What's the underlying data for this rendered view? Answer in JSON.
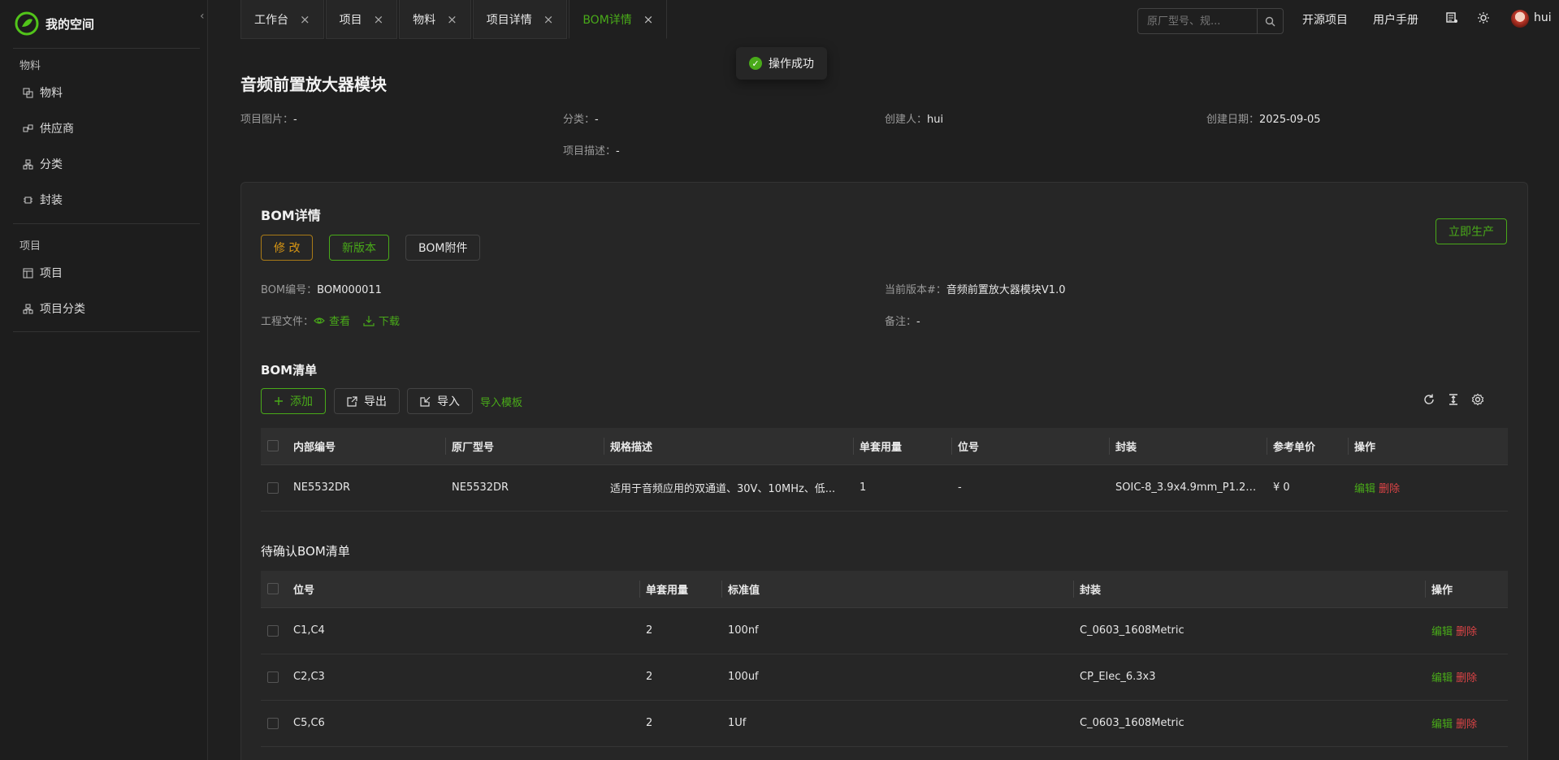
{
  "sidebar": {
    "logo_text": "我的空间",
    "groups": [
      {
        "label": "物料",
        "items": [
          {
            "label": "物料",
            "icon": "materials-icon"
          },
          {
            "label": "供应商",
            "icon": "supplier-icon"
          },
          {
            "label": "分类",
            "icon": "category-icon"
          },
          {
            "label": "封装",
            "icon": "package-icon"
          }
        ]
      },
      {
        "label": "项目",
        "items": [
          {
            "label": "项目",
            "icon": "project-icon"
          },
          {
            "label": "项目分类",
            "icon": "project-category-icon"
          }
        ]
      }
    ]
  },
  "tabs": [
    {
      "label": "工作台",
      "active": false
    },
    {
      "label": "项目",
      "active": false
    },
    {
      "label": "物料",
      "active": false
    },
    {
      "label": "项目详情",
      "active": false
    },
    {
      "label": "BOM详情",
      "active": true
    }
  ],
  "header": {
    "search_placeholder": "原厂型号、规...",
    "open_source": "开源项目",
    "manual": "用户手册",
    "username": "hui"
  },
  "toast": {
    "text": "操作成功"
  },
  "project": {
    "title": "音频前置放大器模块",
    "image_label": "项目图片：",
    "image_value": "-",
    "category_label": "分类：",
    "category_value": "-",
    "creator_label": "创建人：",
    "creator_value": "hui",
    "date_label": "创建日期：",
    "date_value": "2025-09-05",
    "desc_label": "项目描述：",
    "desc_value": "-"
  },
  "bom": {
    "title": "BOM详情",
    "edit_btn": "修 改",
    "new_version_btn": "新版本",
    "attachment_btn": "BOM附件",
    "produce_btn": "立即生产",
    "code_label": "BOM编号：",
    "code_value": "BOM000011",
    "version_label": "当前版本#：",
    "version_value": "音频前置放大器模块V1.0",
    "files_label": "工程文件：",
    "view_link": "查看",
    "download_link": "下载",
    "remark_label": "备注：",
    "remark_value": "-"
  },
  "bom_list": {
    "title": "BOM清单",
    "add_btn": "添加",
    "export_btn": "导出",
    "import_btn": "导入",
    "template_link": "导入模板",
    "columns": [
      "内部编号",
      "原厂型号",
      "规格描述",
      "单套用量",
      "位号",
      "封装",
      "参考单价",
      "操作"
    ],
    "rows": [
      {
        "internal": "NE5532DR",
        "model": "NE5532DR",
        "spec": "适用于音频应用的双通道、30V、10MHz、低...",
        "qty": "1",
        "ref": "-",
        "package": "SOIC-8_3.9x4.9mm_P1.27m...",
        "price": "¥ 0",
        "edit": "编辑",
        "del": "删除"
      }
    ]
  },
  "pending": {
    "title": "待确认BOM清单",
    "columns": [
      "位号",
      "单套用量",
      "标准值",
      "封装",
      "操作"
    ],
    "rows": [
      {
        "ref": "C1,C4",
        "qty": "2",
        "value": "100nf",
        "package": "C_0603_1608Metric",
        "edit": "编辑",
        "del": "删除"
      },
      {
        "ref": "C2,C3",
        "qty": "2",
        "value": "100uf",
        "package": "CP_Elec_6.3x3",
        "edit": "编辑",
        "del": "删除"
      },
      {
        "ref": "C5,C6",
        "qty": "2",
        "value": "1Uf",
        "package": "C_0603_1608Metric",
        "edit": "编辑",
        "del": "删除"
      }
    ]
  },
  "colors": {
    "accent": "#49aa19",
    "warn": "#d89614",
    "danger": "#dc4446",
    "bg": "#1f1f1f"
  }
}
